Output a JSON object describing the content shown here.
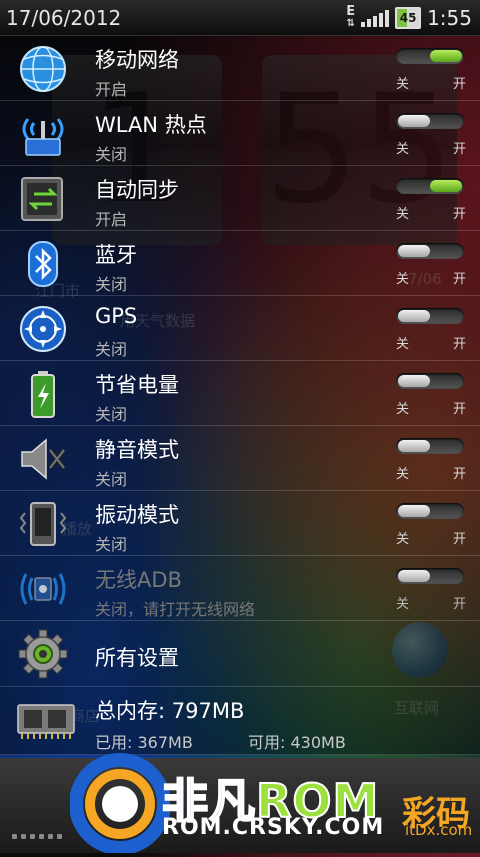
{
  "status_bar": {
    "date": "17/06/2012",
    "network": "E",
    "battery": "45",
    "battery_fraction": 0.45,
    "time": "1:55"
  },
  "background": {
    "clock_hour_digit": "1",
    "clock_minute_digits": "55",
    "ghost_city": "江门市",
    "ghost_data": "用天气数据",
    "ghost_date": "7/06",
    "ghost_play": "播放",
    "ghost_store": "商店",
    "ghost_internet": "互联网"
  },
  "toggle_labels": {
    "off": "关",
    "on": "开"
  },
  "rows": [
    {
      "title": "移动网络",
      "subtitle": "开启",
      "state": "on",
      "icon": "globe-icon"
    },
    {
      "title": "WLAN 热点",
      "subtitle": "关闭",
      "state": "off",
      "icon": "wifi-hotspot-icon"
    },
    {
      "title": "自动同步",
      "subtitle": "开启",
      "state": "on",
      "icon": "sync-icon"
    },
    {
      "title": "蓝牙",
      "subtitle": "关闭",
      "state": "off",
      "icon": "bluetooth-icon"
    },
    {
      "title": "GPS",
      "subtitle": "关闭",
      "state": "off",
      "icon": "gps-icon"
    },
    {
      "title": "节省电量",
      "subtitle": "关闭",
      "state": "off",
      "icon": "battery-saver-icon"
    },
    {
      "title": "静音模式",
      "subtitle": "关闭",
      "state": "off",
      "icon": "speaker-mute-icon"
    },
    {
      "title": "振动模式",
      "subtitle": "关闭",
      "state": "off",
      "icon": "vibrate-icon"
    },
    {
      "title": "无线ADB",
      "subtitle": "关闭，请打开无线网络",
      "state": "off",
      "icon": "wireless-adb-icon",
      "disabled": true
    }
  ],
  "settings_row": {
    "title": "所有设置",
    "icon": "gear-icon"
  },
  "memory_row": {
    "title": "总内存: 797MB",
    "used": "已用: 367MB",
    "free": "可用: 430MB",
    "icon": "memory-chip-icon"
  },
  "watermark": {
    "brand_cn": "非凡",
    "brand_rom": "ROM",
    "url": "ROM.CRSKY.COM",
    "mark": "彩码",
    "mark_sub": "itDx.com"
  },
  "colors": {
    "toggle_on": "#7fc241",
    "brand_blue": "#3c78d8",
    "brand_green": "#9be03c"
  }
}
